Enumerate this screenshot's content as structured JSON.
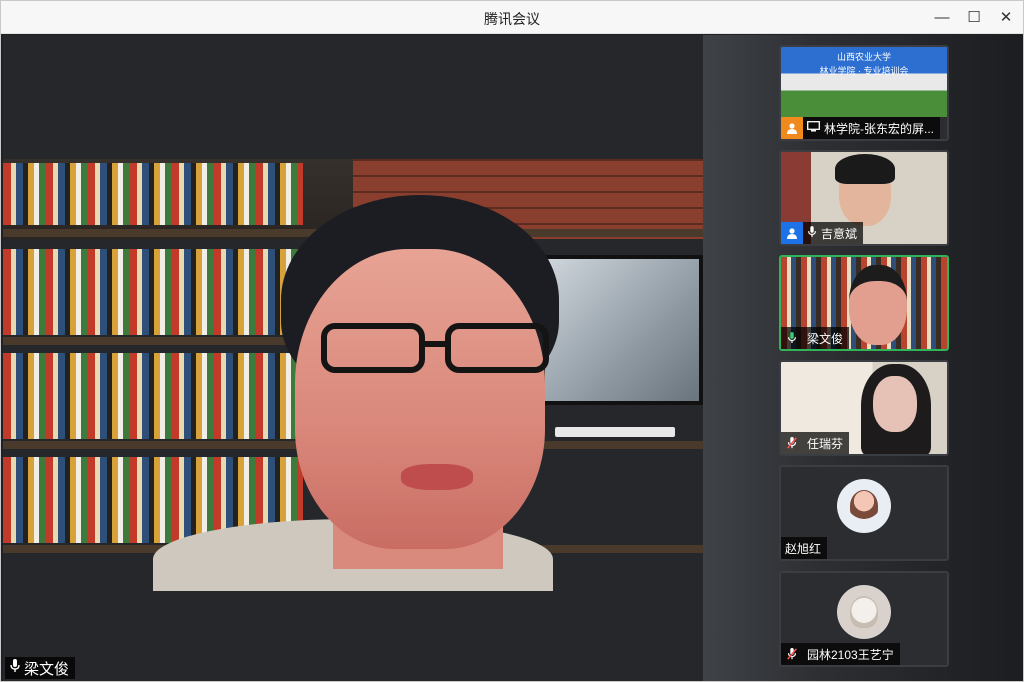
{
  "window": {
    "title": "腾讯会议",
    "controls": {
      "minimize": "—",
      "maximize": "☐",
      "close": "✕"
    }
  },
  "main_view": {
    "speaker_name": "梁文俊",
    "mic_icon": "microphone-icon"
  },
  "participants": [
    {
      "name": "林学院-张东宏的屏...",
      "kind": "screen-share",
      "icons": [
        "person-icon",
        "screen-share-icon"
      ],
      "screen_header": [
        "山西农业大学",
        "林业学院 · 专业培训会"
      ]
    },
    {
      "name": "吉意斌",
      "kind": "video",
      "icons": [
        "person-icon",
        "microphone-icon"
      ]
    },
    {
      "name": "梁文俊",
      "kind": "video",
      "active_speaker": true,
      "icons": [
        "microphone-icon"
      ]
    },
    {
      "name": "任瑞芬",
      "kind": "video",
      "muted": true,
      "icons": [
        "microphone-muted-icon"
      ]
    },
    {
      "name": "赵旭红",
      "kind": "avatar",
      "icons": []
    },
    {
      "name": "园林2103王艺宁",
      "kind": "avatar",
      "muted": true,
      "icons": [
        "microphone-muted-icon"
      ]
    }
  ],
  "colors": {
    "active_speaker_border": "#2fb45a",
    "muted_mic": "#ff4d4d",
    "orange_badge": "#f08a1d",
    "blue_badge": "#1e72e8"
  }
}
